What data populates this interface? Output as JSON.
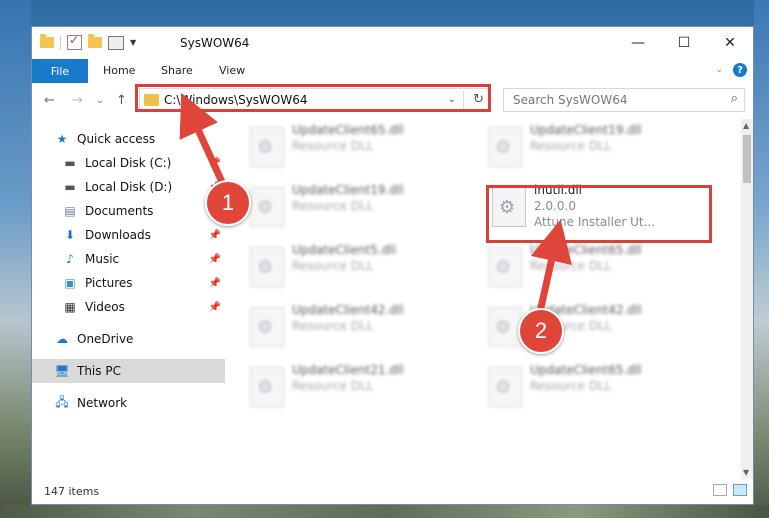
{
  "window": {
    "title": "SysWOW64",
    "controls": {
      "minimize": "—",
      "maximize": "☐",
      "close": "✕"
    }
  },
  "ribbon": {
    "file": "File",
    "tabs": [
      "Home",
      "Share",
      "View"
    ],
    "help": "?"
  },
  "nav": {
    "back": "←",
    "forward": "→",
    "recent": "⌄",
    "up": "↑",
    "address": "C:\\Windows\\SysWOW64",
    "search_placeholder": "Search SysWOW64"
  },
  "sidebar": {
    "items": [
      {
        "label": "Quick access",
        "icon": "star-icon"
      },
      {
        "label": "Local Disk (C:)",
        "icon": "drive-icon"
      },
      {
        "label": "Local Disk (D:)",
        "icon": "drive-icon"
      },
      {
        "label": "Documents",
        "icon": "documents-icon"
      },
      {
        "label": "Downloads",
        "icon": "download-icon"
      },
      {
        "label": "Music",
        "icon": "music-icon"
      },
      {
        "label": "Pictures",
        "icon": "pictures-icon"
      },
      {
        "label": "Videos",
        "icon": "video-icon"
      },
      {
        "label": "OneDrive",
        "icon": "cloud-icon"
      },
      {
        "label": "This PC",
        "icon": "computer-icon"
      },
      {
        "label": "Network",
        "icon": "network-icon"
      }
    ]
  },
  "files": [
    {
      "name": "UpdateClient65.dll",
      "type": "Resource DLL"
    },
    {
      "name": "UpdateClient19.dll",
      "type": "Resource DLL"
    },
    {
      "name": "UpdateClient19.dll",
      "type": "Resource DLL"
    },
    {
      "name": "inutil.dll",
      "version": "2.0.0.0",
      "description": "Attune Installer Ut..."
    },
    {
      "name": "UpdateClient5.dll",
      "type": "Resource DLL"
    },
    {
      "name": "UpdateClient65.dll",
      "type": "Resource DLL"
    },
    {
      "name": "UpdateClient42.dll",
      "type": "Resource DLL"
    },
    {
      "name": "UpdateClient42.dll",
      "type": "Resource DLL"
    },
    {
      "name": "UpdateClient21.dll",
      "type": "Resource DLL"
    },
    {
      "name": "UpdateClient65.dll",
      "type": "Resource DLL"
    }
  ],
  "status": {
    "count": "147 items"
  },
  "annotations": {
    "step1": "1",
    "step2": "2",
    "color": "#e0453a"
  }
}
